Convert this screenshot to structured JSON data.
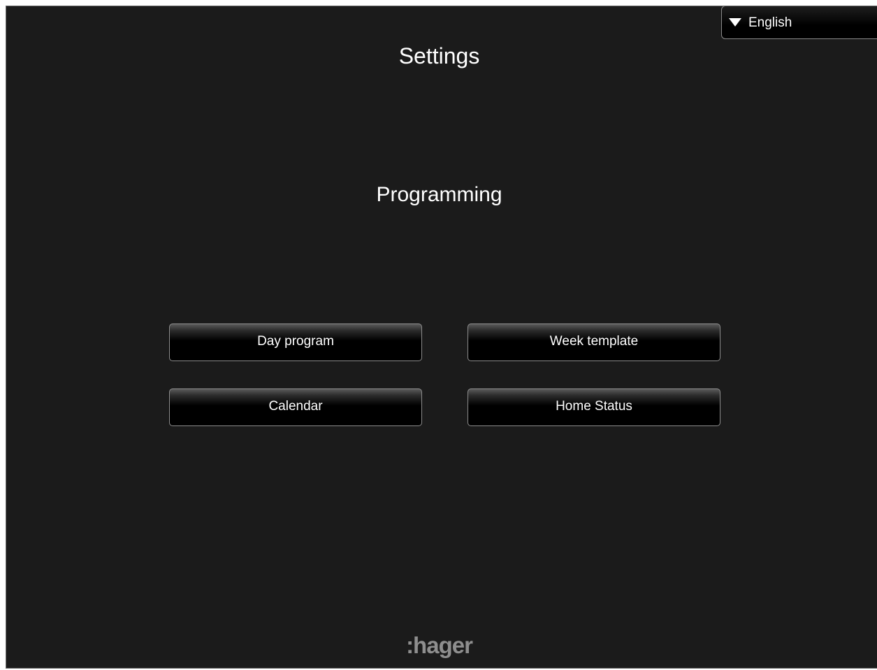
{
  "header": {
    "title": "Settings"
  },
  "language": {
    "selected": "English",
    "icon": "triangle-down-icon"
  },
  "section": {
    "title": "Programming"
  },
  "buttons": {
    "day_program": "Day program",
    "week_template": "Week template",
    "calendar": "Calendar",
    "home_status": "Home Status"
  },
  "footer": {
    "logo_text": ":hager"
  },
  "colors": {
    "background": "#1b1b1b",
    "text": "#ffffff",
    "button_border": "#8c8c8c",
    "logo": "#8e8e8e"
  }
}
